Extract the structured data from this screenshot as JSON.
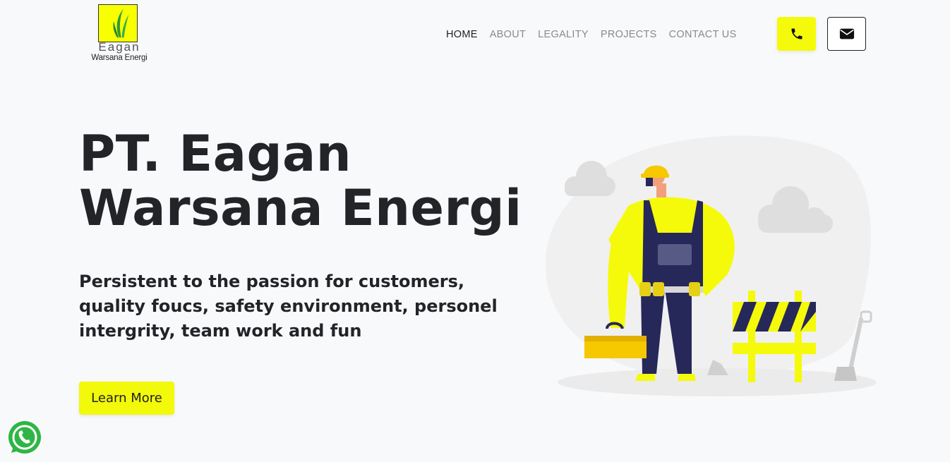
{
  "header": {
    "logo": {
      "name": "Eagan",
      "sub": "Warsana Energi"
    },
    "nav": [
      {
        "label": "HOME",
        "active": true
      },
      {
        "label": "ABOUT",
        "active": false
      },
      {
        "label": "LEGALITY",
        "active": false
      },
      {
        "label": "PROJECTS",
        "active": false
      },
      {
        "label": "CONTACT US",
        "active": false
      }
    ],
    "phone_icon": "phone-icon",
    "mail_icon": "mail-icon"
  },
  "hero": {
    "title_line1": "PT. Eagan",
    "title_line2": "Warsana Energi",
    "subtitle": "Persistent to the passion for customers, quality foucs, safety environment, personel intergrity, team work and fun",
    "cta_label": "Learn More"
  },
  "colors": {
    "accent": "#f5fa0a",
    "text": "#222428",
    "nav_inactive": "#8a8a8a",
    "background": "#f8f9fb",
    "whatsapp": "#2fb545"
  }
}
